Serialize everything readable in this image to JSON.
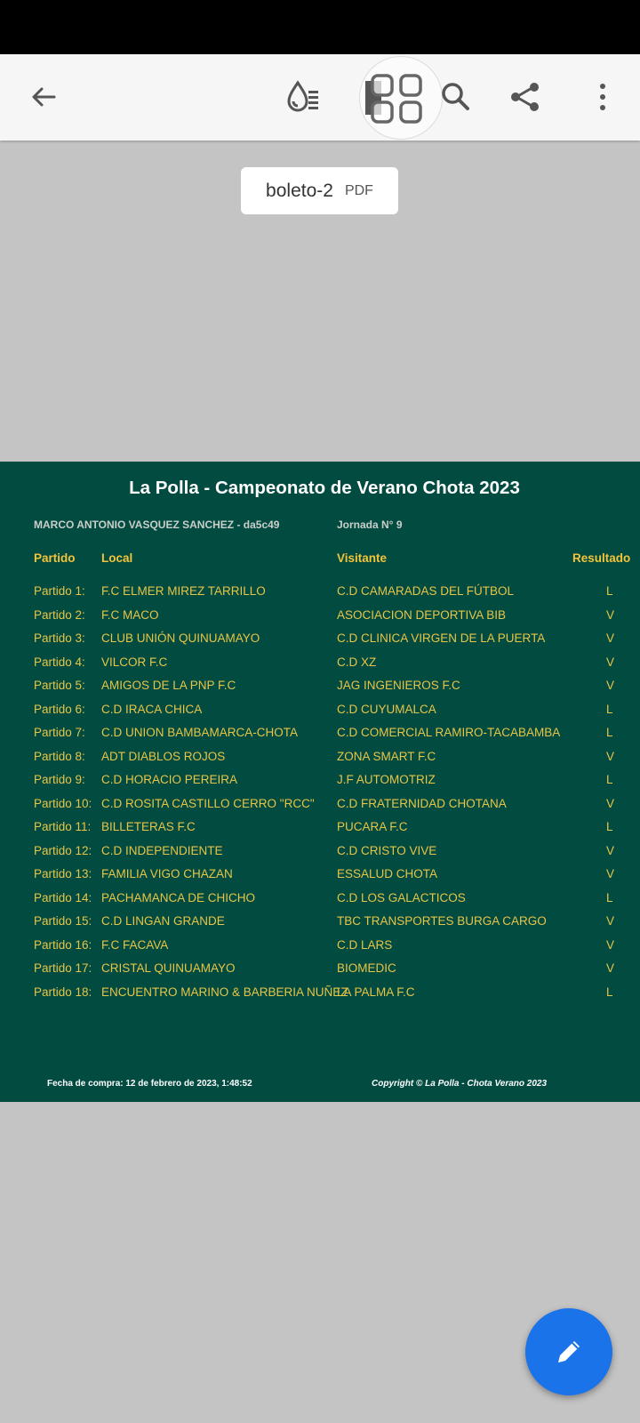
{
  "toolbar": {
    "icons": [
      "back-arrow-icon",
      "liquid-mode-icon",
      "app-grid-icon",
      "search-icon",
      "share-icon",
      "more-vert-icon"
    ]
  },
  "document": {
    "name": "boleto-2",
    "type": "PDF"
  },
  "ticket": {
    "title": "La Polla - Campeonato de Verano Chota 2023",
    "player": "MARCO ANTONIO VASQUEZ SANCHEZ  - da5c49",
    "jornada": "Jornada N° 9",
    "headers": {
      "partido": "Partido",
      "local": "Local",
      "visitante": "Visitante",
      "resultado": "Resultado"
    },
    "matches": [
      {
        "partido": "Partido 1:",
        "local": "F.C ELMER MIREZ TARRILLO",
        "visitante": "C.D CAMARADAS DEL FÚTBOL",
        "resultado": "L"
      },
      {
        "partido": "Partido 2:",
        "local": "F.C MACO",
        "visitante": "ASOCIACION DEPORTIVA BIB",
        "resultado": "V"
      },
      {
        "partido": "Partido 3:",
        "local": "CLUB UNIÓN QUINUAMAYO",
        "visitante": "C.D CLINICA VIRGEN DE LA PUERTA",
        "resultado": "V"
      },
      {
        "partido": "Partido 4:",
        "local": "VILCOR F.C",
        "visitante": "C.D XZ",
        "resultado": "V"
      },
      {
        "partido": "Partido 5:",
        "local": "AMIGOS DE LA PNP F.C",
        "visitante": "JAG INGENIEROS F.C",
        "resultado": "V"
      },
      {
        "partido": "Partido 6:",
        "local": "C.D IRACA CHICA",
        "visitante": "C.D CUYUMALCA",
        "resultado": "L"
      },
      {
        "partido": "Partido 7:",
        "local": "C.D UNION BAMBAMARCA-CHOTA",
        "visitante": "C.D COMERCIAL RAMIRO-TACABAMBA",
        "resultado": "L"
      },
      {
        "partido": "Partido 8:",
        "local": "ADT DIABLOS ROJOS",
        "visitante": "ZONA SMART F.C",
        "resultado": "V"
      },
      {
        "partido": "Partido 9:",
        "local": "C.D HORACIO PEREIRA",
        "visitante": "J.F AUTOMOTRIZ",
        "resultado": "L"
      },
      {
        "partido": "Partido 10:",
        "local": "C.D ROSITA CASTILLO CERRO \"RCC\"",
        "visitante": "C.D FRATERNIDAD CHOTANA",
        "resultado": "V"
      },
      {
        "partido": "Partido 11:",
        "local": "BILLETERAS F.C",
        "visitante": "PUCARA F.C",
        "resultado": "L"
      },
      {
        "partido": "Partido 12:",
        "local": "C.D INDEPENDIENTE",
        "visitante": "C.D CRISTO VIVE",
        "resultado": "V"
      },
      {
        "partido": "Partido 13:",
        "local": "FAMILIA VIGO CHAZAN",
        "visitante": "ESSALUD CHOTA",
        "resultado": "V"
      },
      {
        "partido": "Partido 14:",
        "local": "PACHAMANCA DE CHICHO",
        "visitante": "C.D LOS GALACTICOS",
        "resultado": "L"
      },
      {
        "partido": "Partido 15:",
        "local": "C.D LINGAN GRANDE",
        "visitante": "TBC TRANSPORTES BURGA CARGO",
        "resultado": "V"
      },
      {
        "partido": "Partido 16:",
        "local": "F.C FACAVA",
        "visitante": "C.D LARS",
        "resultado": "V"
      },
      {
        "partido": "Partido 17:",
        "local": "CRISTAL QUINUAMAYO",
        "visitante": "BIOMEDIC",
        "resultado": "V"
      },
      {
        "partido": "Partido 18:",
        "local": "ENCUENTRO MARINO & BARBERIA NUÑEZ",
        "visitante": "LA PALMA F.C",
        "resultado": "L"
      }
    ],
    "footer_left": "Fecha de compra: 12 de febrero de 2023, 1:48:52",
    "footer_right": "Copyright © La Polla - Chota Verano 2023"
  },
  "fab": {
    "icon": "pencil-icon"
  },
  "colors": {
    "page_bg": "#024b41",
    "accent_text": "#f3c43a",
    "fab": "#1a73e8"
  }
}
